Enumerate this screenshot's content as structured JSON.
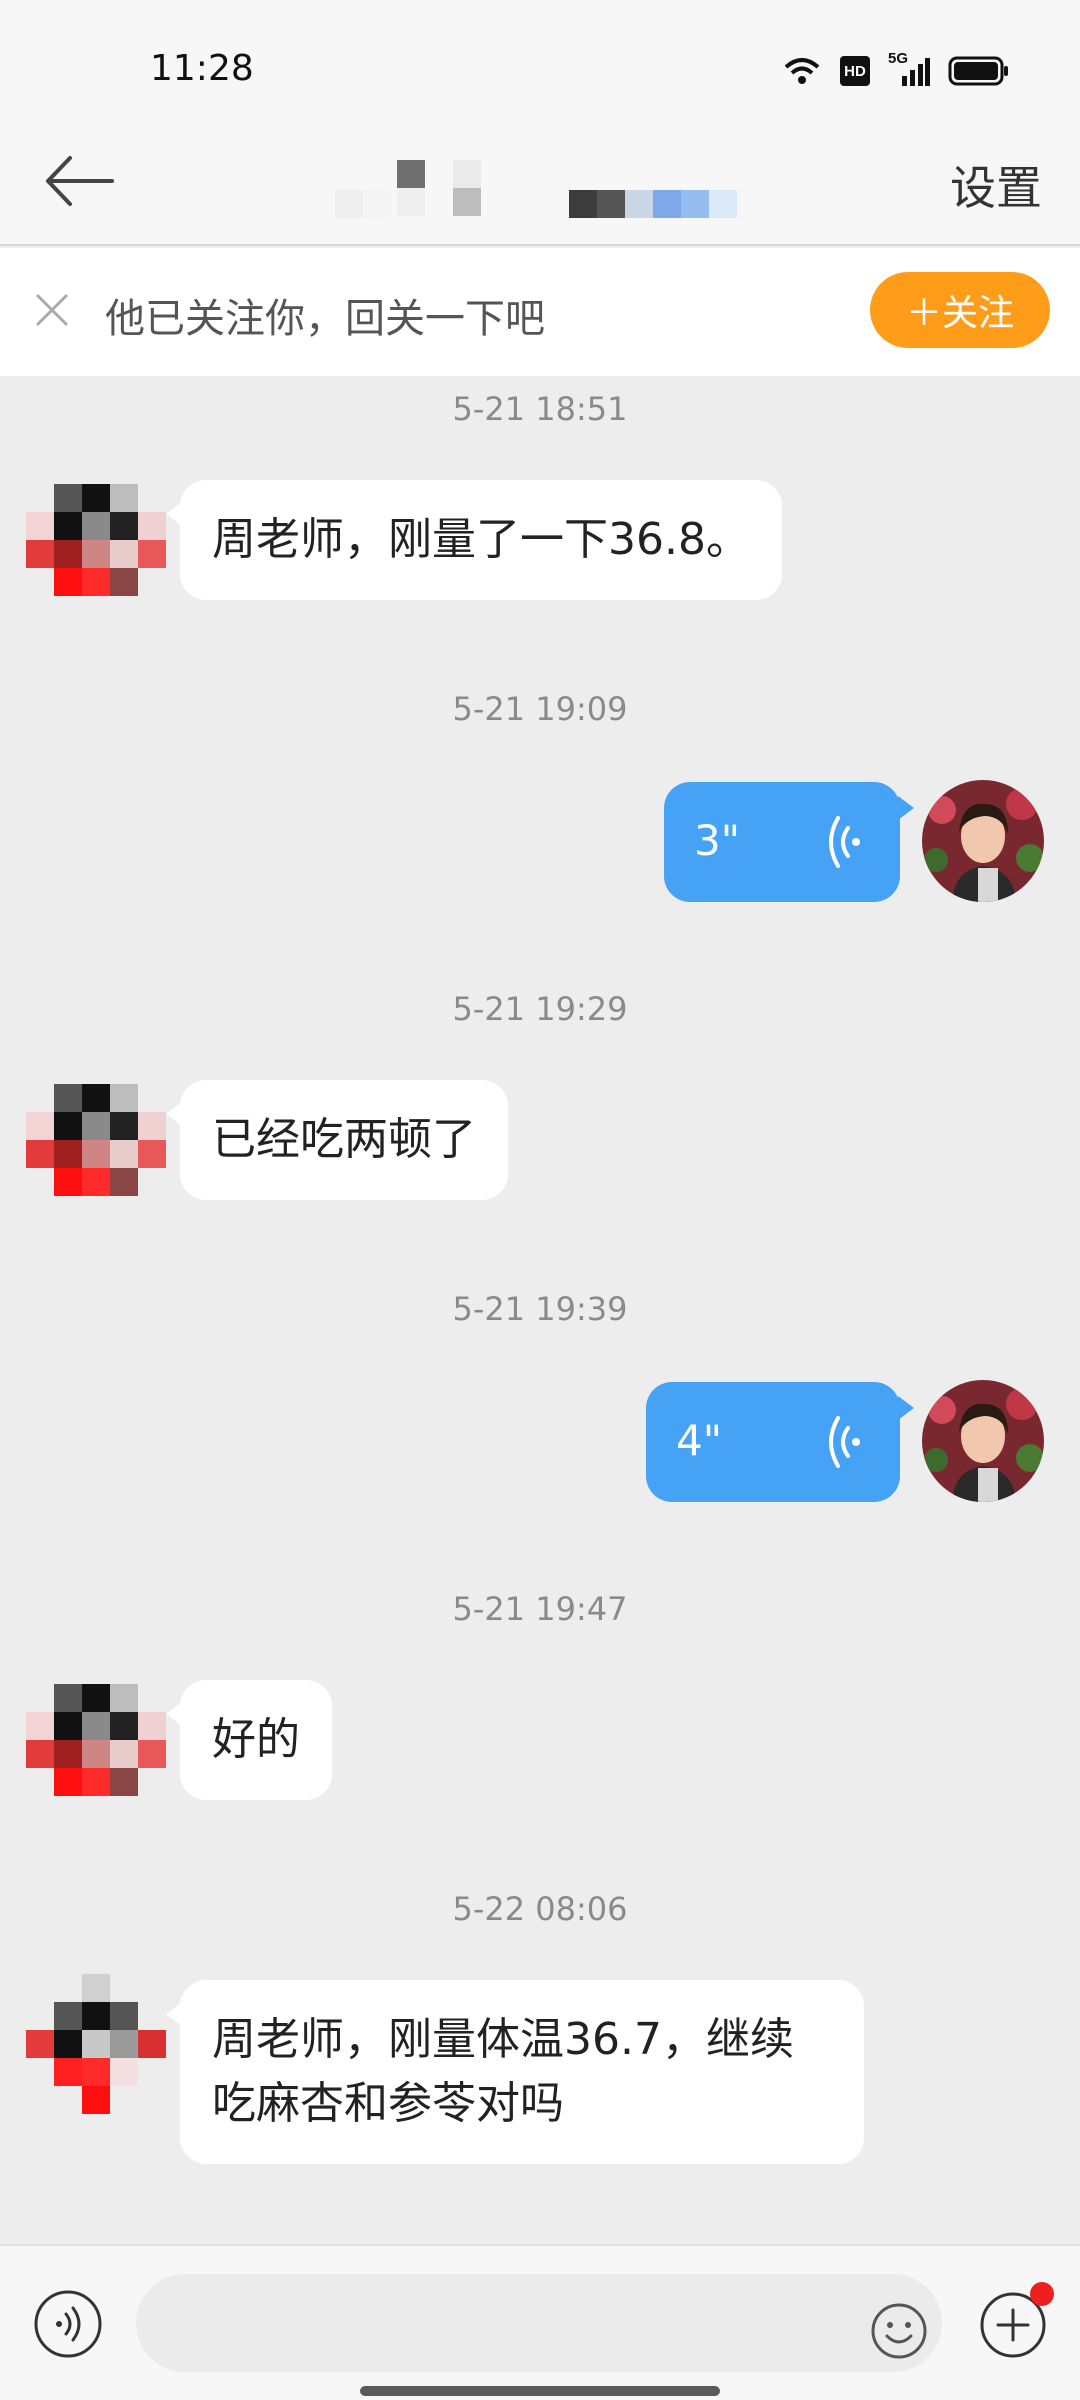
{
  "status_bar": {
    "time": "11:28",
    "hd_badge": "HD",
    "network": "5G"
  },
  "header": {
    "back_icon": "arrow-left-icon",
    "settings_label": "设置"
  },
  "follow_banner": {
    "text": "他已关注你，回关一下吧",
    "button_label": "＋关注"
  },
  "messages": [
    {
      "timestamp": "5-21 18:51",
      "side": "left",
      "type": "text",
      "text": "周老师，刚量了一下36.8。"
    },
    {
      "timestamp": "5-21 19:09",
      "side": "right",
      "type": "voice",
      "duration": "3\""
    },
    {
      "timestamp": "5-21 19:29",
      "side": "left",
      "type": "text",
      "text": "已经吃两顿了"
    },
    {
      "timestamp": "5-21 19:39",
      "side": "right",
      "type": "voice",
      "duration": "4\""
    },
    {
      "timestamp": "5-21 19:47",
      "side": "left",
      "type": "text",
      "text": "好的"
    },
    {
      "timestamp": "5-22 08:06",
      "side": "left",
      "type": "text",
      "text": "周老师，刚量体温36.7，继续吃麻杏和参苓对吗"
    }
  ],
  "colors": {
    "accent_orange": "#ff9c1a",
    "voice_bubble_blue": "#46a2f5",
    "chat_background": "#ededed"
  }
}
